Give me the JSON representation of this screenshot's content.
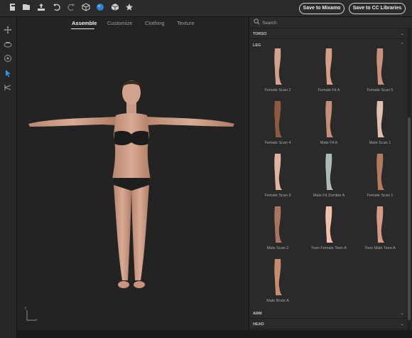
{
  "toolbar": {
    "icons": [
      "new-file-icon",
      "save-icon",
      "export-icon",
      "undo-icon",
      "redo-icon",
      "cube-icon",
      "sphere-icon",
      "box-icon",
      "star-icon"
    ],
    "save_mixamo_label": "Save to Mixamo",
    "save_cc_label": "Save to CC Libraries"
  },
  "left_tools": [
    "move-icon",
    "orbit-icon",
    "target-icon",
    "pointer-icon",
    "pose-icon"
  ],
  "tabs": [
    {
      "label": "Assemble",
      "active": true
    },
    {
      "label": "Customize",
      "active": false
    },
    {
      "label": "Clothing",
      "active": false
    },
    {
      "label": "Texture",
      "active": false
    }
  ],
  "panel": {
    "search_placeholder": "Search",
    "sections": {
      "torso": "TORSO",
      "leg": "LEG",
      "arm": "ARM",
      "head": "HEAD"
    },
    "leg_items": [
      {
        "label": "Female Scan 2",
        "skin": "#d2a28d"
      },
      {
        "label": "Female Fit A",
        "skin": "#d6a088"
      },
      {
        "label": "Female Scan 5",
        "skin": "#c9917c"
      },
      {
        "label": "Female Scan 4",
        "skin": "#8c5a3e"
      },
      {
        "label": "Male Fit A",
        "skin": "#c58f78"
      },
      {
        "label": "Male Scan 1",
        "skin": "#e0c0ae"
      },
      {
        "label": "Female Scan 3",
        "skin": "#e2b4a0"
      },
      {
        "label": "Male Fit Zombie A",
        "skin": "#aebbb0"
      },
      {
        "label": "Female Scan 1",
        "skin": "#b27a5e"
      },
      {
        "label": "Male Scan 2",
        "skin": "#a87560"
      },
      {
        "label": "Toon Female Teen A",
        "skin": "#f0c2aa"
      },
      {
        "label": "Toon Male Teen A",
        "skin": "#d49a84"
      },
      {
        "label": "Male Brute A",
        "skin": "#c68c6e"
      }
    ]
  },
  "axis_labels": {
    "y": "y",
    "x": "x"
  }
}
